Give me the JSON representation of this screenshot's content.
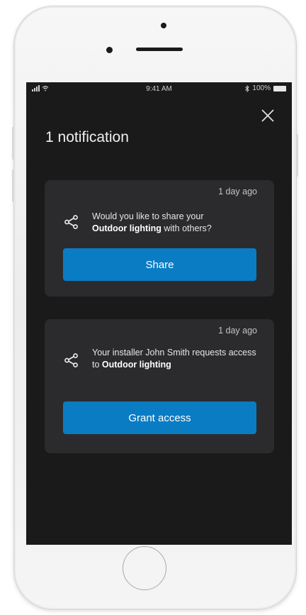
{
  "status_bar": {
    "time": "9:41 AM",
    "battery": "100%"
  },
  "icons": {
    "close": "close-icon",
    "share": "share-icon"
  },
  "colors": {
    "screen_bg": "#1a1a1a",
    "card_bg": "#2b2b2d",
    "accent": "#0a7cc4"
  },
  "header": {
    "title": "1 notification"
  },
  "notifications": [
    {
      "time": "1 day ago",
      "line1_prefix": "Would you like to share your",
      "line2_bold": "Outdoor lighting",
      "line2_suffix": " with others?",
      "button_label": "Share"
    },
    {
      "time": "1 day ago",
      "line1_prefix": "Your installer John Smith requests access",
      "line2_prefix": "to ",
      "line2_bold": "Outdoor lighting",
      "button_label": "Grant access"
    }
  ]
}
